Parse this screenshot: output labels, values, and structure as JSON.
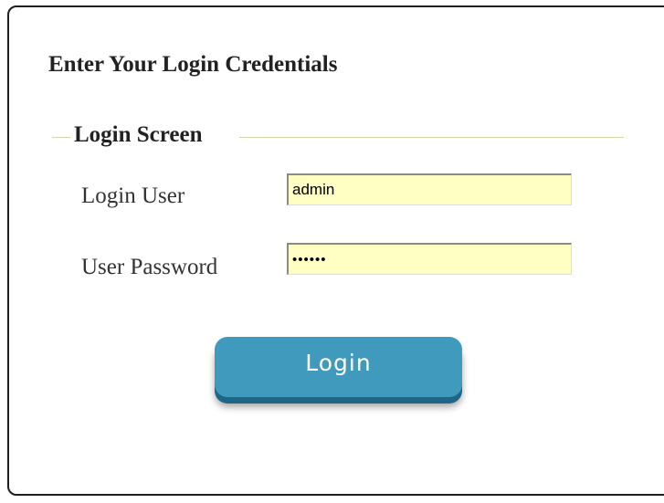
{
  "form": {
    "heading": "Enter Your Login Credentials",
    "legend": "Login Screen",
    "fields": {
      "user": {
        "label": "Login User",
        "value": "admin"
      },
      "password": {
        "label": "User Password",
        "value": "••••••"
      }
    },
    "submit_label": "Login"
  },
  "colors": {
    "input_background": "#ffffc4",
    "button": "#3f9abd",
    "button_shadow": "#1f6686",
    "legend_line": "#c9d9a8"
  }
}
